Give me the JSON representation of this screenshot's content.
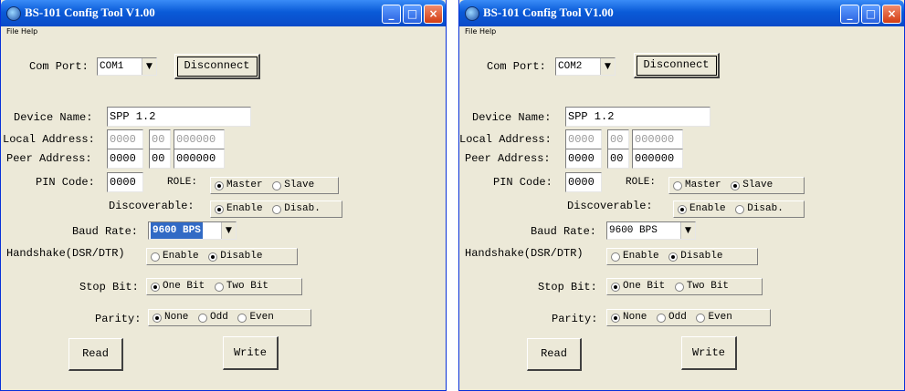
{
  "windows": [
    {
      "title": "BS-101 Config Tool V1.00",
      "menu": [
        "File",
        "Help"
      ],
      "com_port": {
        "label": "Com Port:",
        "value": "COM1"
      },
      "disconnect_label": "Disconnect",
      "device_name": {
        "label": "Device Name:",
        "value": "SPP 1.2"
      },
      "local_address": {
        "label": "Local Address:",
        "parts": [
          "0000",
          "00",
          "000000"
        ]
      },
      "peer_address": {
        "label": "Peer Address:",
        "parts": [
          "0000",
          "00",
          "000000"
        ]
      },
      "pin_code": {
        "label": "PIN Code:",
        "value": "0000"
      },
      "role": {
        "label": "ROLE:",
        "options": [
          "Master",
          "Slave"
        ],
        "selected": 0
      },
      "discoverable": {
        "label": "Discoverable:",
        "options": [
          "Enable",
          "Disab."
        ],
        "selected": 0
      },
      "baud_rate": {
        "label": "Baud Rate:",
        "value": "9600 BPS"
      },
      "handshake": {
        "label": "Handshake(DSR/DTR)",
        "options": [
          "Enable",
          "Disable"
        ],
        "selected": 1
      },
      "stop_bit": {
        "label": "Stop Bit:",
        "options": [
          "One Bit",
          "Two Bit"
        ],
        "selected": 0
      },
      "parity": {
        "label": "Parity:",
        "options": [
          "None",
          "Odd",
          "Even"
        ],
        "selected": 0
      },
      "read_label": "Read",
      "write_label": "Write"
    },
    {
      "title": "BS-101 Config Tool V1.00",
      "menu": [
        "File",
        "Help"
      ],
      "com_port": {
        "label": "Com Port:",
        "value": "COM2"
      },
      "disconnect_label": "Disconnect",
      "device_name": {
        "label": "Device Name:",
        "value": "SPP 1.2"
      },
      "local_address": {
        "label": "Local Address:",
        "parts": [
          "0000",
          "00",
          "000000"
        ]
      },
      "peer_address": {
        "label": "Peer Address:",
        "parts": [
          "0000",
          "00",
          "000000"
        ]
      },
      "pin_code": {
        "label": "PIN Code:",
        "value": "0000"
      },
      "role": {
        "label": "ROLE:",
        "options": [
          "Master",
          "Slave"
        ],
        "selected": 1
      },
      "discoverable": {
        "label": "Discoverable:",
        "options": [
          "Enable",
          "Disab."
        ],
        "selected": 0
      },
      "baud_rate": {
        "label": "Baud Rate:",
        "value": "9600 BPS"
      },
      "handshake": {
        "label": "Handshake(DSR/DTR)",
        "options": [
          "Enable",
          "Disable"
        ],
        "selected": 1
      },
      "stop_bit": {
        "label": "Stop Bit:",
        "options": [
          "One Bit",
          "Two Bit"
        ],
        "selected": 0
      },
      "parity": {
        "label": "Parity:",
        "options": [
          "None",
          "Odd",
          "Even"
        ],
        "selected": 0
      },
      "read_label": "Read",
      "write_label": "Write"
    }
  ]
}
